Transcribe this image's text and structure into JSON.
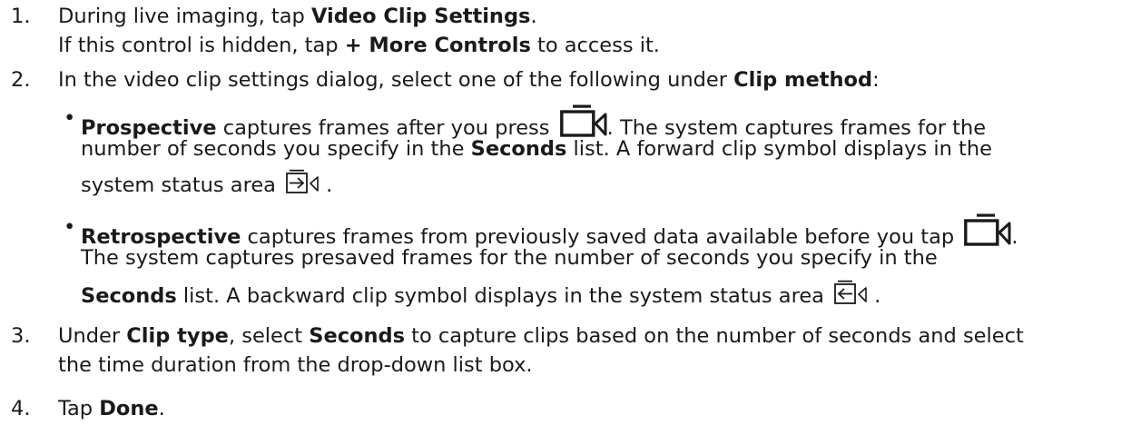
{
  "steps": [
    {
      "number": "1.",
      "line1_before": "During live imaging, tap ",
      "line1_bold": "Video Clip Settings",
      "line1_after": ".",
      "line2_before": "If this control is hidden, tap ",
      "line2_bold": "+ More Controls",
      "line2_after": " to access it."
    },
    {
      "number": "2.",
      "line1_before": "In the video clip settings dialog, select one of the following under ",
      "line1_bold": "Clip method",
      "line1_after": ":",
      "bullets": [
        {
          "bullet": "•",
          "l1_bold": "Prospective",
          "l1_text": " captures frames after you press ",
          "l1_after": ". The system captures frames for the",
          "l2_text": "number of seconds you specify in the ",
          "l2_bold": "Seconds",
          "l2_after": " list. A forward clip symbol displays in the",
          "l3_text": "system status area ",
          "l3_after": ".",
          "status_icon": "forward-clip-icon"
        },
        {
          "bullet": "•",
          "l1_bold": "Retrospective",
          "l1_text": " captures frames from previously saved data available before you tap ",
          "l1_after": ".",
          "l2_text": "The system captures presaved frames for the number of seconds you specify in the",
          "l3_bold": "Seconds",
          "l3_text": " list. A backward clip symbol displays in the system status area ",
          "l3_after": ".",
          "status_icon": "backward-clip-icon"
        }
      ]
    },
    {
      "number": "3.",
      "line1_before": "Under ",
      "line1_bold": "Clip type",
      "line1_mid": ", select ",
      "line1_bold2": "Seconds",
      "line1_after": " to capture clips based on the number of seconds and select",
      "line2_before": "the time duration from the drop-down list box."
    },
    {
      "number": "4.",
      "line1_before": "Tap ",
      "line1_bold": "Done",
      "line1_after": "."
    }
  ],
  "icons": {
    "record": "video-record-icon",
    "forward": "forward-clip-icon",
    "backward": "backward-clip-icon"
  }
}
